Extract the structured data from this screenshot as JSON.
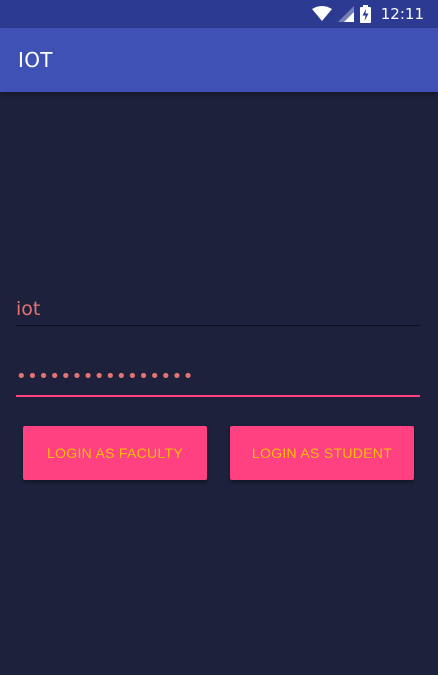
{
  "status_bar": {
    "time": "12:11",
    "icons": [
      "wifi-icon",
      "signal-icon",
      "battery-charging-icon"
    ]
  },
  "app_bar": {
    "title": "IOT"
  },
  "login_form": {
    "username_value": "iot",
    "password_value": "••••••••••••••••",
    "faculty_button_label": "LOGIN AS FACULTY",
    "student_button_label": "LOGIN AS STUDENT"
  },
  "colors": {
    "status_bar": "#2d3a91",
    "app_bar": "#3f51b5",
    "background": "#1d213b",
    "accent": "#ff4081",
    "button_text": "#ffc107",
    "input_text": "#e57373"
  }
}
